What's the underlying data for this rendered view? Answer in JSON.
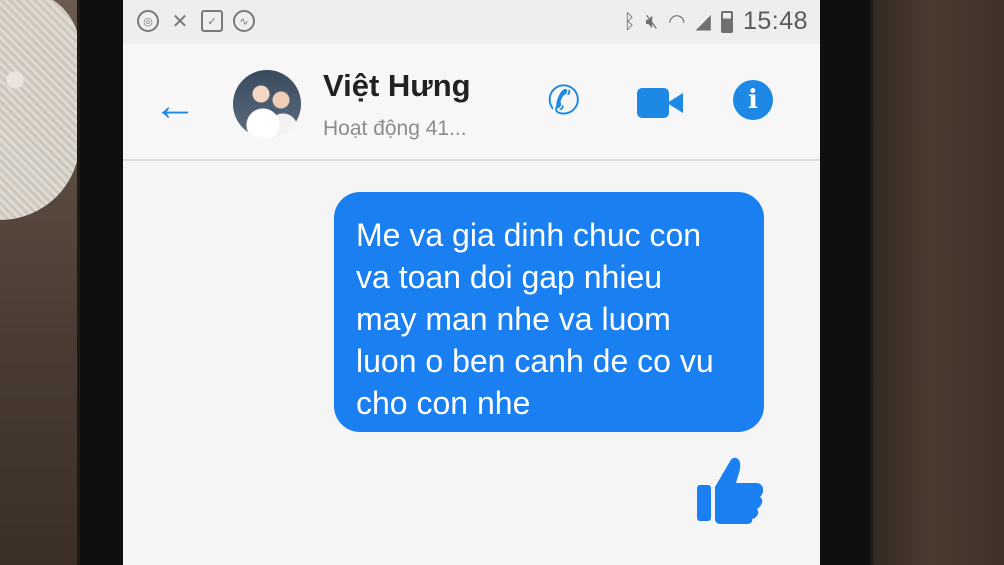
{
  "status_bar": {
    "time": "15:48",
    "icons": [
      "chrome-icon",
      "missed-call-icon",
      "checklist-icon",
      "messenger-icon",
      "bluetooth-icon",
      "mute-icon",
      "wifi-icon",
      "signal-icon",
      "battery-icon"
    ]
  },
  "header": {
    "contact_name": "Việt Hưng",
    "presence": "Hoạt động 41...",
    "actions": [
      "back-arrow-icon",
      "phone-icon",
      "video-icon",
      "info-icon"
    ]
  },
  "messages": [
    {
      "from": "me",
      "text": "Me va gia dinh chuc con\nva toan doi gap nhieu\nmay man nhe va luom\nluon o ben canh de co vu\ncho con nhe"
    }
  ],
  "colors": {
    "accent": "#1e88e5",
    "bubble": "#1a7ff0"
  }
}
